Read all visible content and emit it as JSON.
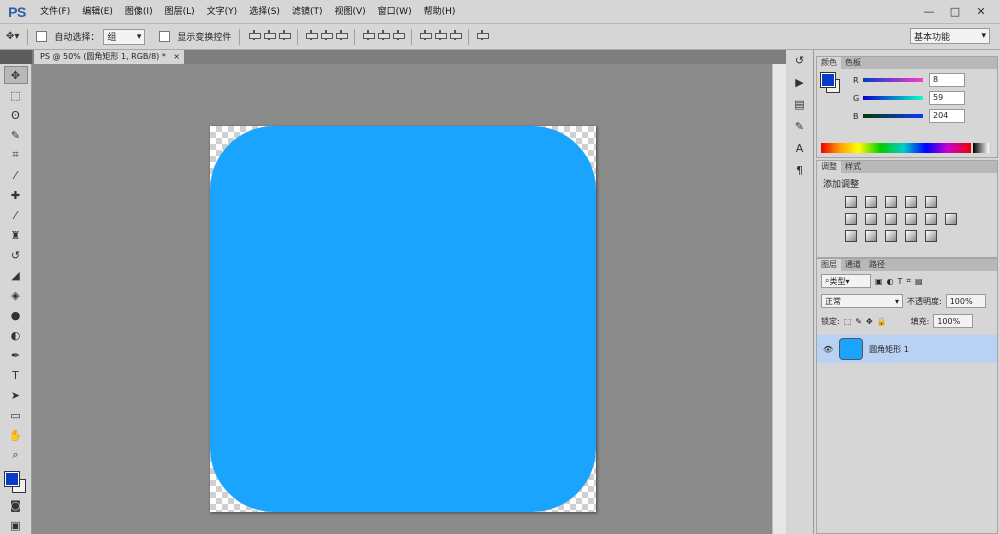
{
  "app": {
    "logo": "PS"
  },
  "menu": [
    "文件(F)",
    "编辑(E)",
    "图像(I)",
    "图层(L)",
    "文字(Y)",
    "选择(S)",
    "滤镜(T)",
    "视图(V)",
    "窗口(W)",
    "帮助(H)"
  ],
  "window_controls": {
    "minimize": "—",
    "maximize": "□",
    "close": "✕"
  },
  "options": {
    "move_tool_icon": "move-icon",
    "auto_select_label": "自动选择：",
    "auto_select_value": "组",
    "transform_label": "显示变换控件",
    "workspace": "基本功能"
  },
  "document": {
    "tab_title": "PS @ 50% (圆角矩形 1, RGB/8) *",
    "tab_close": "×",
    "shape_color": "#1ba4fd"
  },
  "color_panel": {
    "tabs": [
      "颜色",
      "色板"
    ],
    "r": {
      "label": "R",
      "value": "8"
    },
    "g": {
      "label": "G",
      "value": "59"
    },
    "b": {
      "label": "B",
      "value": "204"
    },
    "foreground": "#083bcc"
  },
  "adjustments_panel": {
    "tabs": [
      "调整",
      "样式"
    ],
    "title": "添加调整"
  },
  "layers_panel": {
    "tabs": [
      "图层",
      "通道",
      "路径"
    ],
    "filter": "类型",
    "blend_mode": "正常",
    "opacity_label": "不透明度:",
    "opacity": "100%",
    "lock_label": "锁定:",
    "fill_label": "填充:",
    "fill": "100%",
    "layers": [
      {
        "name": "圆角矩形 1"
      }
    ]
  }
}
